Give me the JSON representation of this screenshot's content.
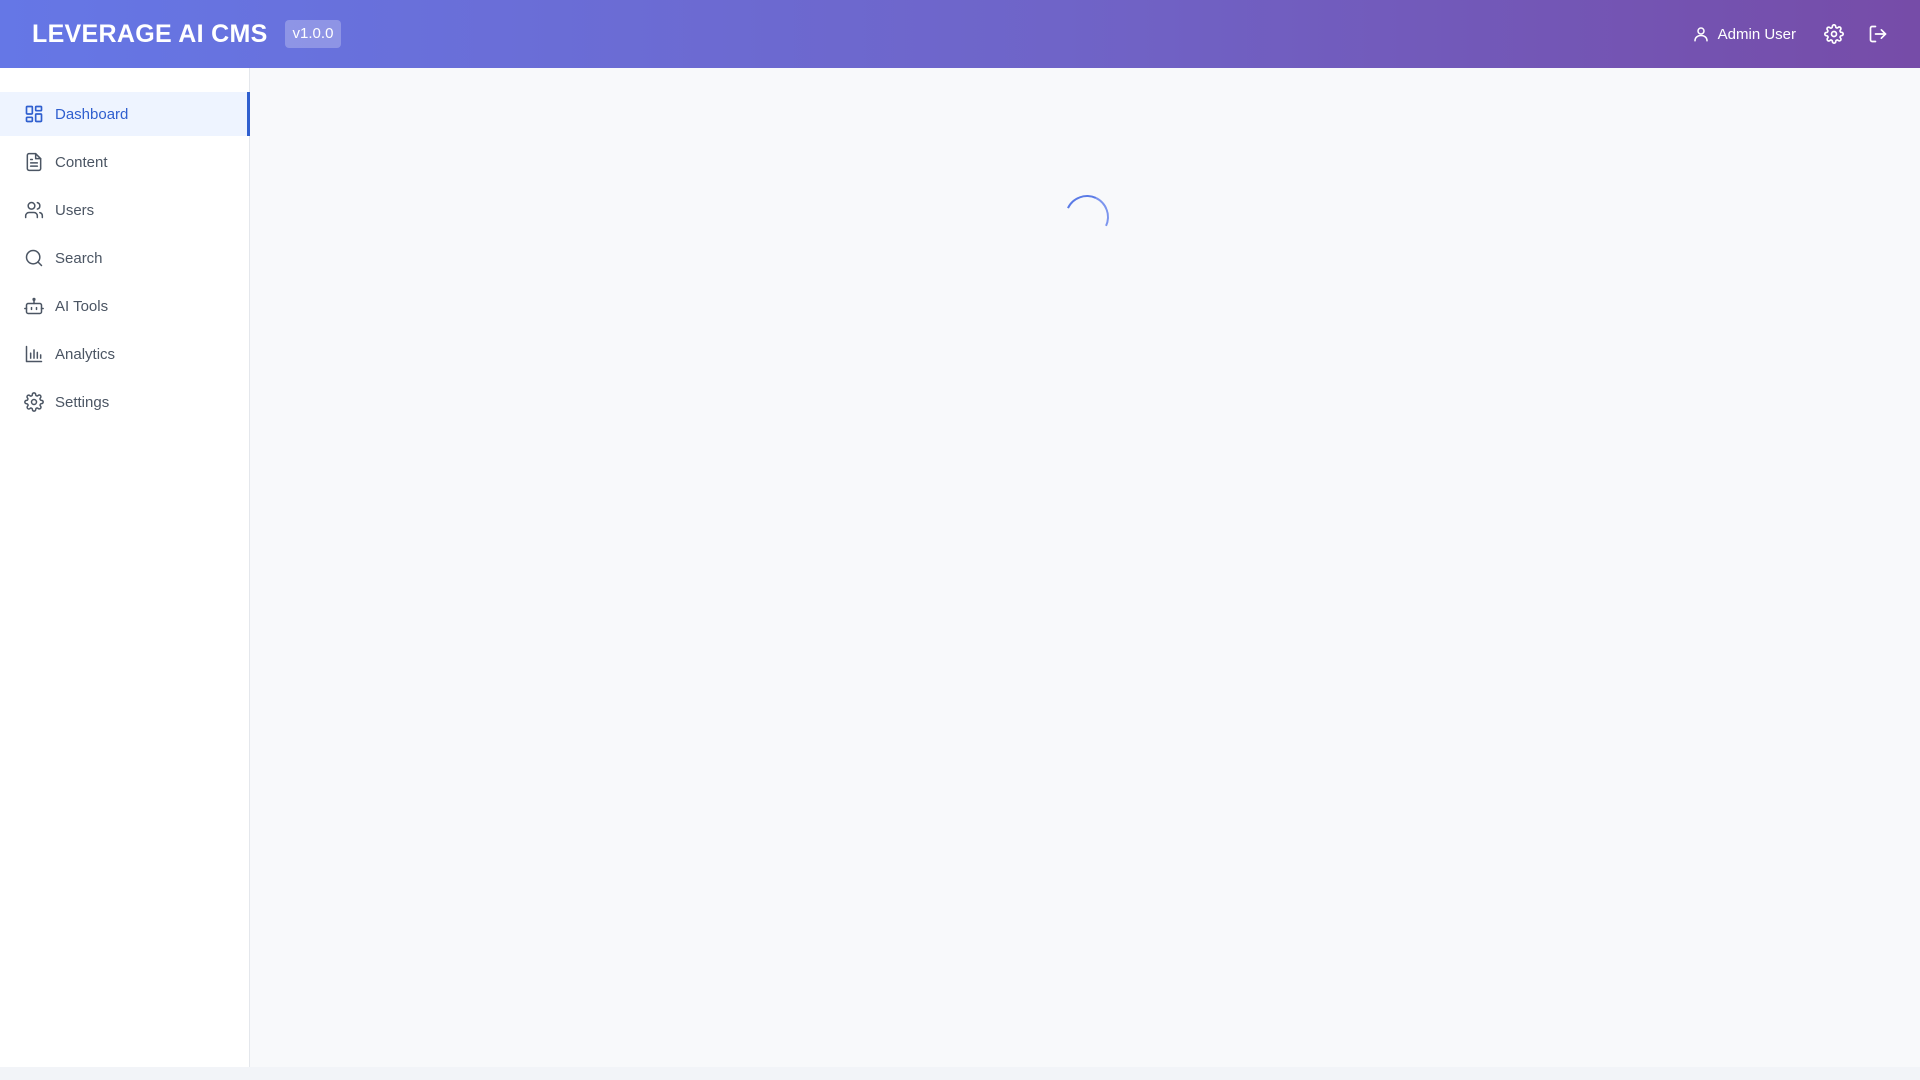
{
  "header": {
    "title": "LEVERAGE AI CMS",
    "version": "v1.0.0",
    "user_name": "Admin User",
    "user_icon": "user-icon",
    "settings_icon": "gear-icon",
    "logout_icon": "logout-icon"
  },
  "sidebar": {
    "items": [
      {
        "label": "Dashboard",
        "icon": "dashboard-icon",
        "active": true
      },
      {
        "label": "Content",
        "icon": "document-icon",
        "active": false
      },
      {
        "label": "Users",
        "icon": "users-icon",
        "active": false
      },
      {
        "label": "Search",
        "icon": "search-icon",
        "active": false
      },
      {
        "label": "AI Tools",
        "icon": "robot-icon",
        "active": false
      },
      {
        "label": "Analytics",
        "icon": "bar-chart-icon",
        "active": false
      },
      {
        "label": "Settings",
        "icon": "gear-icon",
        "active": false
      }
    ]
  },
  "main": {
    "state": "loading"
  },
  "colors": {
    "header_gradient_start": "#6577e6",
    "header_gradient_end": "#764ca8",
    "accent": "#2f5fcf",
    "active_bg": "#eef4ff",
    "sidebar_text": "#4b5563"
  }
}
